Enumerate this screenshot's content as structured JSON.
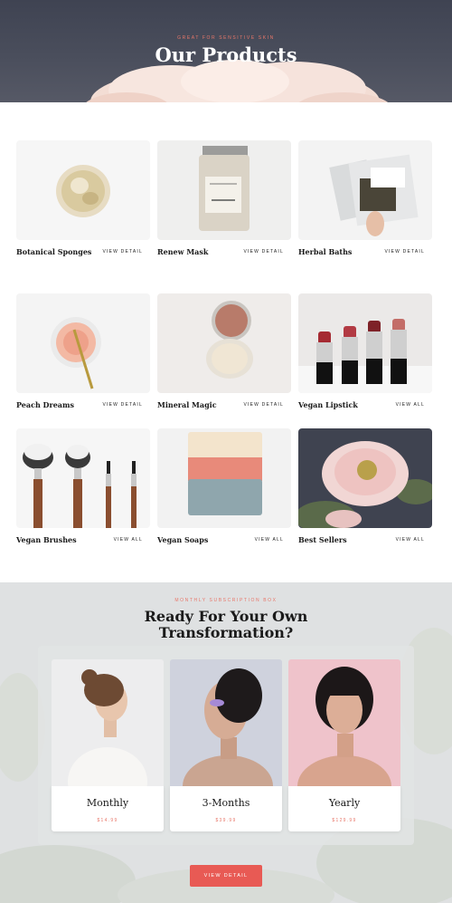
{
  "hero": {
    "eyebrow": "Great for sensitive skin",
    "title": "Our Products"
  },
  "products": [
    {
      "name": "Botanical Sponges",
      "link": "View Detail",
      "image": "loofah-sponge"
    },
    {
      "name": "Renew Mask",
      "link": "View Detail",
      "image": "mask-jar"
    },
    {
      "name": "Herbal Baths",
      "link": "View Detail",
      "image": "herb-bag"
    },
    {
      "name": "Peach Dreams",
      "link": "View Detail",
      "image": "blush-pot"
    },
    {
      "name": "Mineral Magic",
      "link": "View Detail",
      "image": "compact-mirror"
    },
    {
      "name": "Vegan Lipstick",
      "link": "View All",
      "image": "lipsticks"
    },
    {
      "name": "Vegan Brushes",
      "link": "View All",
      "image": "brushes"
    },
    {
      "name": "Vegan Soaps",
      "link": "View All",
      "image": "soap-bar"
    },
    {
      "name": "Best Sellers",
      "link": "View All",
      "image": "peony"
    }
  ],
  "subscription": {
    "eyebrow": "Monthly subscription box",
    "title": "Ready For Your Own Transformation?",
    "plans": [
      {
        "title": "Monthly",
        "price": "$14.99",
        "image": "woman-side-profile"
      },
      {
        "title": "3-Months",
        "price": "$39.99",
        "image": "woman-purple-eyeshadow"
      },
      {
        "title": "Yearly",
        "price": "$129.99",
        "image": "woman-bangs-pink"
      }
    ],
    "cta": "View Detail"
  },
  "colors": {
    "accent": "#e85a54",
    "eyebrow": "#e8776a",
    "hero_bg": "#454957",
    "section_bg": "#dfe1e2"
  }
}
